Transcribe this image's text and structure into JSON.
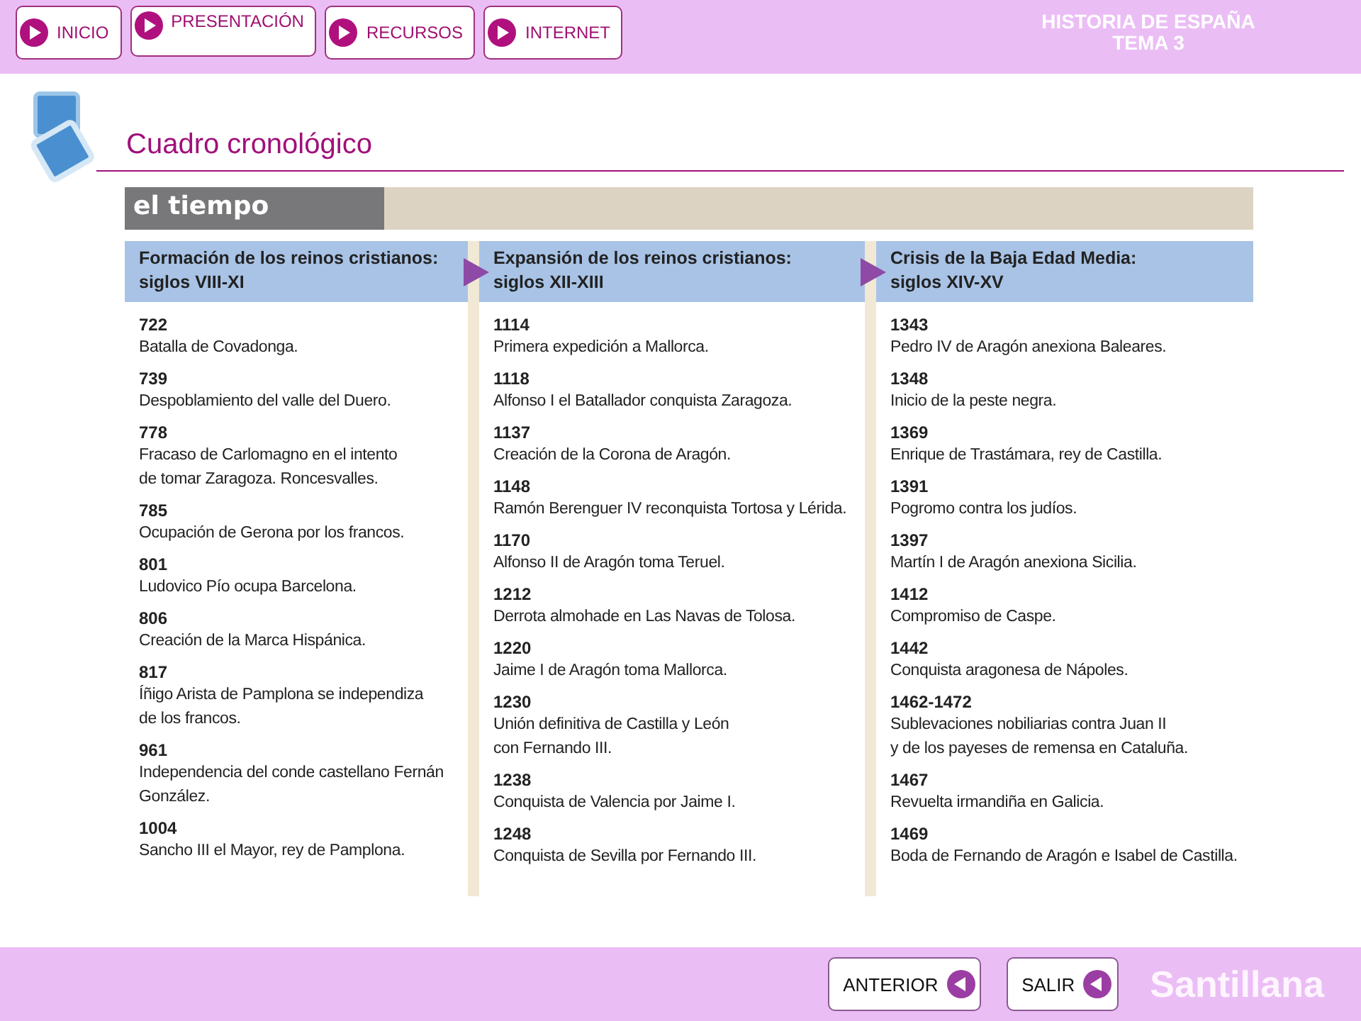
{
  "nav_buttons": [
    "INICIO",
    "PRESENTACIÓN",
    "RECURSOS",
    "INTERNET"
  ],
  "course": {
    "title": "HISTORIA DE ESPAÑA",
    "subtitle": "TEMA 3"
  },
  "page_title": "Cuadro cronológico",
  "panel_title": "el tiempo",
  "columns": [
    {
      "heading": "Formación de los reinos cristianos:",
      "period": "siglos VIII-XI",
      "events": [
        {
          "year": "722",
          "text": "Batalla de Covadonga."
        },
        {
          "year": "739",
          "text": "Despoblamiento del valle del Duero."
        },
        {
          "year": "778",
          "text": "Fracaso de Carlomagno en el intento\nde tomar Zaragoza. Roncesvalles."
        },
        {
          "year": "785",
          "text": "Ocupación de Gerona por los francos."
        },
        {
          "year": "801",
          "text": "Ludovico Pío ocupa Barcelona."
        },
        {
          "year": "806",
          "text": "Creación de la Marca Hispánica."
        },
        {
          "year": "817",
          "text": "Íñigo Arista de Pamplona se independiza\nde los francos."
        },
        {
          "year": "961",
          "text": "Independencia del conde castellano Fernán\nGonzález."
        },
        {
          "year": "1004",
          "text": "Sancho III el Mayor, rey de Pamplona."
        }
      ]
    },
    {
      "heading": "Expansión de los reinos cristianos:",
      "period": "siglos XII-XIII",
      "events": [
        {
          "year": "1114",
          "text": "Primera expedición a Mallorca."
        },
        {
          "year": "1118",
          "text": "Alfonso I el Batallador conquista Zaragoza."
        },
        {
          "year": "1137",
          "text": "Creación de la Corona de Aragón."
        },
        {
          "year": "1148",
          "text": "Ramón Berenguer IV reconquista Tortosa y Lérida."
        },
        {
          "year": "1170",
          "text": "Alfonso II de Aragón toma Teruel."
        },
        {
          "year": "1212",
          "text": "Derrota almohade en Las Navas de Tolosa."
        },
        {
          "year": "1220",
          "text": "Jaime I de Aragón toma Mallorca."
        },
        {
          "year": "1230",
          "text": "Unión definitiva de Castilla y León\ncon Fernando III."
        },
        {
          "year": "1238",
          "text": "Conquista de Valencia por Jaime I."
        },
        {
          "year": "1248",
          "text": "Conquista de Sevilla por Fernando III."
        }
      ]
    },
    {
      "heading": "Crisis de la Baja Edad Media:",
      "period": "siglos XIV-XV",
      "events": [
        {
          "year": "1343",
          "text": "Pedro IV de Aragón anexiona Baleares."
        },
        {
          "year": "1348",
          "text": "Inicio de la peste negra."
        },
        {
          "year": "1369",
          "text": "Enrique de Trastámara, rey de Castilla."
        },
        {
          "year": "1391",
          "text": "Pogromo contra los judíos."
        },
        {
          "year": "1397",
          "text": "Martín I de Aragón anexiona Sicilia."
        },
        {
          "year": "1412",
          "text": "Compromiso de Caspe."
        },
        {
          "year": "1442",
          "text": "Conquista aragonesa de Nápoles."
        },
        {
          "year": "1462-1472",
          "text": "Sublevaciones nobiliarias contra Juan II\ny de los payeses de remensa en Cataluña."
        },
        {
          "year": "1467",
          "text": "Revuelta irmandiña en Galicia."
        },
        {
          "year": "1469",
          "text": "Boda de Fernando de Aragón e Isabel de Castilla."
        }
      ]
    }
  ],
  "footer_buttons": [
    "ANTERIOR",
    "SALIR"
  ],
  "brand": "Santillana"
}
